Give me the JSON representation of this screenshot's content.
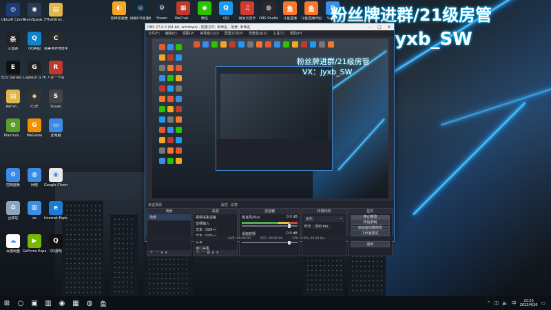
{
  "overlay": {
    "line1": "粉丝牌进群/21级房管",
    "line2": "VX：jyxb_SW"
  },
  "desktop_icons": [
    {
      "label": "Ubisoft Connect",
      "color": "#1d3b7a",
      "glyph": "◎",
      "icon": "ubisoft-icon"
    },
    {
      "label": "TeamSpeak 3",
      "color": "#2b3b55",
      "glyph": "◉",
      "icon": "teamspeak-icon"
    },
    {
      "label": "TheOther…",
      "color": "#e1b64a",
      "glyph": "▤",
      "icon": "folder-icon"
    },
    {
      "label": "三国杀",
      "color": "#222",
      "glyph": "杀",
      "icon": "sanguosha-icon"
    },
    {
      "label": "QQ拼图",
      "color": "#0f84c9",
      "glyph": "Q",
      "icon": "qq-puzzle-icon"
    },
    {
      "label": "完美世界竞技平台",
      "color": "#2a2a2a",
      "glyph": "C",
      "icon": "perfectworld-icon"
    },
    {
      "label": "Epic Games Launcher",
      "color": "#111",
      "glyph": "E",
      "icon": "epic-icon"
    },
    {
      "label": "Logitech G HUB",
      "color": "#222",
      "glyph": "G",
      "icon": "logitech-icon"
    },
    {
      "label": "人生一下车",
      "color": "#c0392b",
      "glyph": "R",
      "icon": "app-icon"
    },
    {
      "label": "Admin…",
      "color": "#e1b64a",
      "glyph": "▤",
      "icon": "folder-icon"
    },
    {
      "label": "iCUE",
      "color": "#333",
      "glyph": "◈",
      "icon": "icue-icon"
    },
    {
      "label": "Squad",
      "color": "#444",
      "glyph": "S",
      "icon": "squad-icon"
    },
    {
      "label": "PlantsVs…",
      "color": "#5c9b2d",
      "glyph": "✿",
      "icon": "plants-icon"
    },
    {
      "label": "WeGame",
      "color": "#f29100",
      "glyph": "G",
      "icon": "wegame-icon"
    },
    {
      "label": "此电脑",
      "color": "#3b8ce6",
      "glyph": "▭",
      "icon": "computer-icon"
    },
    {
      "label": "控制面板",
      "color": "#3b8ce6",
      "glyph": "⚙",
      "icon": "control-panel-icon"
    },
    {
      "label": "网络",
      "color": "#3b8ce6",
      "glyph": "◍",
      "icon": "network-icon"
    },
    {
      "label": "Google Chrome",
      "color": "#e8e8e8",
      "glyph": "◉",
      "icon": "chrome-icon"
    },
    {
      "label": "回收站",
      "color": "#8aa6bf",
      "glyph": "♻",
      "icon": "recycle-bin-icon"
    },
    {
      "label": "xx",
      "color": "#3b8ce6",
      "glyph": "▥",
      "icon": "app-icon"
    },
    {
      "label": "Internet Explorer",
      "color": "#1c7bd6",
      "glyph": "e",
      "icon": "ie-icon"
    },
    {
      "label": "百度网盘",
      "color": "#ffffff",
      "glyph": "☁",
      "icon": "baidu-icon"
    },
    {
      "label": "GeForce Experience",
      "color": "#76b900",
      "glyph": "▶",
      "icon": "geforce-icon"
    },
    {
      "label": "QQ游戏",
      "color": "#111",
      "glyph": "Q",
      "icon": "qq-game-icon"
    }
  ],
  "top_icons": [
    {
      "label": "雷神加速器",
      "color": "#f5a623",
      "glyph": "◐",
      "icon": "leishen-icon"
    },
    {
      "label": "网易UU加速器",
      "color": "#0f2a3a",
      "glyph": "◎",
      "icon": "uu-icon"
    },
    {
      "label": "Steam",
      "color": "#1b2838",
      "glyph": "⚙",
      "icon": "steam-icon"
    },
    {
      "label": "WeChat…",
      "color": "#c0392b",
      "glyph": "▦",
      "icon": "app-icon"
    },
    {
      "label": "微信",
      "color": "#2dc100",
      "glyph": "◉",
      "icon": "wechat-icon"
    },
    {
      "label": "QQ",
      "color": "#1d9bf0",
      "glyph": "Q",
      "icon": "qq-icon"
    },
    {
      "label": "网易云音乐",
      "color": "#d33a31",
      "glyph": "♫",
      "icon": "netease-music-icon"
    },
    {
      "label": "OBS Studio",
      "color": "#2a2a2a",
      "glyph": "◍",
      "icon": "obs-icon"
    },
    {
      "label": "斗鱼直播",
      "color": "#f7782a",
      "glyph": "鱼",
      "icon": "douyu-icon"
    },
    {
      "label": "斗鱼直播伴侣",
      "color": "#f7782a",
      "glyph": "鱼",
      "icon": "douyu-companion-icon"
    },
    {
      "label": "Sam…",
      "color": "#3b8ce6",
      "glyph": "S",
      "icon": "app-icon"
    }
  ],
  "obs": {
    "title": "OBS 27.0.0 (64-bit, windows) - 配置文件: 未命名 - 场景: 未命名",
    "menu": [
      "文件(F)",
      "编辑(E)",
      "视图(V)",
      "停靠窗口(D)",
      "配置文件(P)",
      "场景集合(S)",
      "工具(T)",
      "帮助(H)"
    ],
    "preview_overlay_1": "粉丝牌进群/21级房管",
    "preview_overlay_2": "VX：jyxb_SW",
    "scene_label": "未选择源",
    "scene_props": "属性",
    "scene_filters": "滤镜",
    "panels": {
      "scenes": {
        "header": "场景",
        "items": [
          "场景"
        ]
      },
      "sources": {
        "header": "来源",
        "items": [
          "视频采集设备",
          "音频输入",
          "文本（GDI+）",
          "文本（GDI+）",
          "文本",
          "窗口采集"
        ]
      },
      "mixer": {
        "header": "混音器",
        "channels": [
          {
            "name": "麦克风/Aux",
            "db": "0.0 dB"
          },
          {
            "name": "桌面音频",
            "db": "0.0 dB"
          }
        ]
      },
      "transitions": {
        "header": "转场特效",
        "type": "淡化",
        "duration_label": "时长",
        "duration": "300 ms"
      },
      "controls": {
        "header": "控件",
        "buttons": [
          "停止推流",
          "开始录制",
          "启动虚拟摄像机",
          "工作室模式",
          "设置",
          "退出"
        ]
      }
    },
    "status": {
      "live": "LIVE: 00:00:00",
      "rec": "REC: 00:00:00",
      "cpu": "CPU: 0.0%, 60.00 fps"
    }
  },
  "taskbar": {
    "pinned": [
      {
        "glyph": "⊞",
        "name": "start-icon"
      },
      {
        "glyph": "○",
        "name": "search-icon"
      },
      {
        "glyph": "▣",
        "name": "task-view-icon"
      },
      {
        "glyph": "▥",
        "name": "file-explorer-icon"
      },
      {
        "glyph": "◉",
        "name": "edge-icon"
      },
      {
        "glyph": "▦",
        "name": "app-icon"
      },
      {
        "glyph": "◍",
        "name": "obs-icon"
      },
      {
        "glyph": "鱼",
        "name": "douyu-icon"
      }
    ],
    "time": "21:25",
    "date": "2022/4/26"
  }
}
